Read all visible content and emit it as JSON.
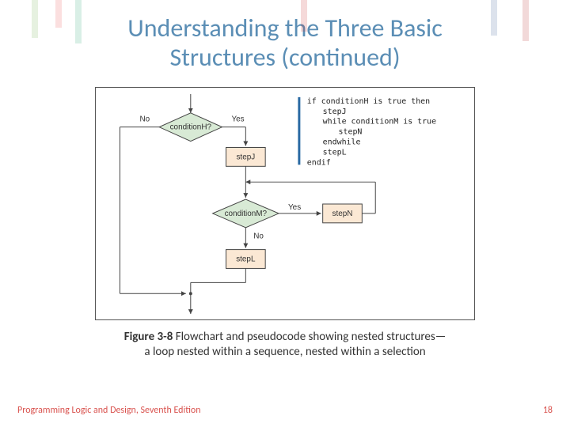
{
  "title_line1": "Understanding the Three Basic",
  "title_line2": "Structures (continued)",
  "diagram": {
    "labels": {
      "no_top": "No",
      "yes_top": "Yes",
      "conditionH": "conditionH?",
      "stepJ": "stepJ",
      "conditionM": "conditionM?",
      "yes_mid": "Yes",
      "no_mid": "No",
      "stepN": "stepN",
      "stepL": "stepL"
    },
    "pseudocode": {
      "l1": "if conditionH is true then",
      "l2": "stepJ",
      "l3": "while conditionM is true",
      "l4": "stepN",
      "l5": "endwhile",
      "l6": "stepL",
      "l7": "endif"
    }
  },
  "caption_bold": "Figure 3-8",
  "caption_rest1": " Flowchart and pseudocode showing nested structures—",
  "caption_rest2": "a loop nested within a sequence, nested within a selection",
  "footer_text": "Programming Logic and Design, Seventh Edition",
  "page_number": "18"
}
